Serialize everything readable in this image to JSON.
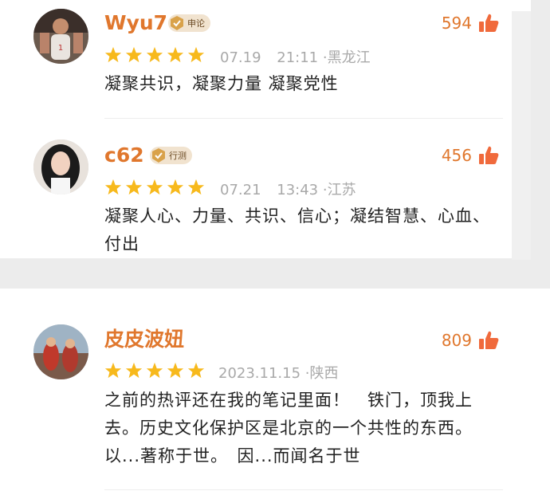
{
  "comments": [
    {
      "username": "Wyu7",
      "badge": "申论",
      "likes": "594",
      "rating": 5,
      "date": "07.19",
      "time": "21:11",
      "location": "黑龙江",
      "text": "凝聚共识，凝聚力量 凝聚党性"
    },
    {
      "username": "c62",
      "badge": "行测",
      "likes": "456",
      "rating": 5,
      "date": "07.21",
      "time": "13:43",
      "location": "江苏",
      "text": "凝聚人心、力量、共识、信心；凝结智慧、心血、付出"
    },
    {
      "username": "皮皮波妞",
      "likes": "809",
      "rating": 5,
      "date": "2023.11.15",
      "location": "陕西",
      "text": "之前的热评还在我的笔记里面！　铁门，顶我上去。历史文化保护区是北京的一个共性的东西。　以...著称于世。　因...而闻名于世"
    }
  ],
  "meta_separator": "·",
  "colors": {
    "accent": "#e0772d",
    "star": "#f7b91c",
    "meta": "#a9a9a9",
    "badge_bg": "#f1e3cf"
  },
  "icons": {
    "like": "thumbs-up-icon",
    "star": "star-icon",
    "badge": "verified-badge-icon"
  }
}
